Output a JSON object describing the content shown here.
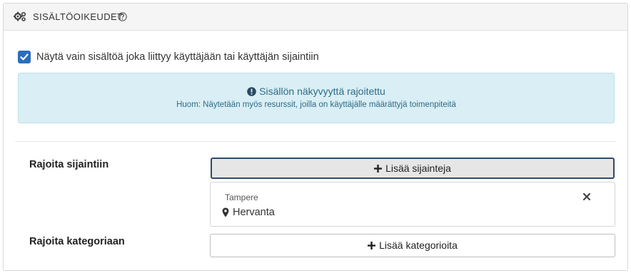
{
  "header": {
    "title": "SISÄLTÖOIKEUDET",
    "icon": "gears-icon",
    "help_icon": "question-circle-icon"
  },
  "restrict_checkbox": {
    "checked": true,
    "label": "Näytä vain sisältöä joka liittyy käyttäjään tai käyttäjän sijaintiin"
  },
  "alert": {
    "icon": "exclamation-circle-icon",
    "title": "Sisällön näkyvyyttä rajoitettu",
    "subtitle": "Huom: Näytetään myös resurssit, joilla on käyttäjälle määrättyjä toimenpiteitä"
  },
  "locations": {
    "label": "Rajoita sijaintiin",
    "add_button": "Lisää sijainteja",
    "items": [
      {
        "parent": "Tampere",
        "name": "Hervanta"
      }
    ]
  },
  "categories": {
    "label": "Rajoita kategoriaan",
    "add_button": "Lisää kategorioita"
  },
  "colors": {
    "checkbox": "#2a6ebb",
    "alert_bg": "#d9eef5",
    "alert_text": "#2f6c86",
    "focus_border": "#2f4a6b"
  }
}
